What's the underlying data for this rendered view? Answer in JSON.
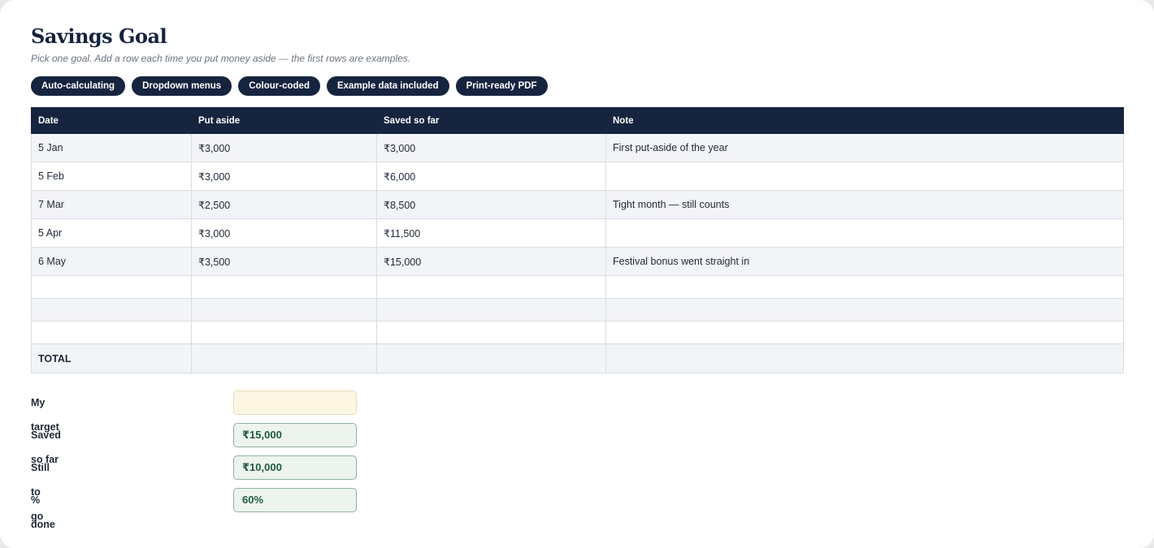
{
  "page": {
    "title": "Savings Goal",
    "subtitle": "Pick one goal. Add a row each time you put money aside — the first rows are examples."
  },
  "tags": [
    "Auto-calculating",
    "Dropdown menus",
    "Colour-coded",
    "Example data included",
    "Print-ready PDF"
  ],
  "table": {
    "headers": [
      "Date",
      "Put aside",
      "Saved so far",
      "Note"
    ],
    "rows": [
      {
        "date": "5 Jan",
        "put_aside": "₹3,000",
        "saved": "₹3,000",
        "note": "First put-aside of the year"
      },
      {
        "date": "5 Feb",
        "put_aside": "₹3,000",
        "saved": "₹6,000",
        "note": ""
      },
      {
        "date": "7 Mar",
        "put_aside": "₹2,500",
        "saved": "₹8,500",
        "note": "Tight month — still counts"
      },
      {
        "date": "5 Apr",
        "put_aside": "₹3,000",
        "saved": "₹11,500",
        "note": ""
      },
      {
        "date": "6 May",
        "put_aside": "₹3,500",
        "saved": "₹15,000",
        "note": "Festival bonus went straight in"
      }
    ],
    "total_label": "TOTAL"
  },
  "summary": {
    "target_label": "My target",
    "target_value": "",
    "saved_label": "Saved so far",
    "saved_value": "₹15,000",
    "remaining_label": "Still to go",
    "remaining_value": "₹10,000",
    "percent_label": "% done",
    "percent_value": "60%"
  },
  "colors": {
    "navy": "#16243f",
    "stripe": "#f3f4f8",
    "target_fill": "#fcf6e3",
    "result_fill": "#edf3ef",
    "result_text": "#1f5c3a"
  }
}
